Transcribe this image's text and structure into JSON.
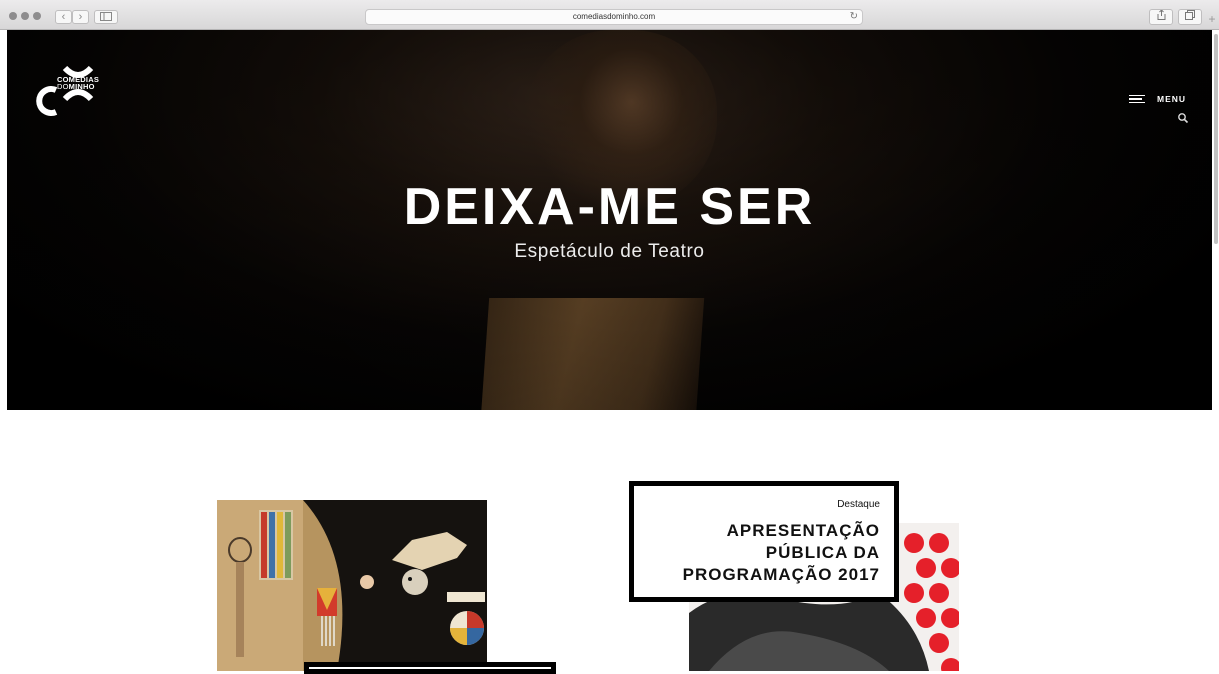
{
  "browser": {
    "url": "comediasdominho.com"
  },
  "site": {
    "logo_text_line1": "COMÉDIAS",
    "logo_text_line2_a": "DO",
    "logo_text_line2_b": "MINHO",
    "menu_label": "MENU"
  },
  "hero": {
    "title": "DEIXA-ME SER",
    "subtitle": "Espetáculo de Teatro"
  },
  "cards": [
    {
      "tag": "",
      "title": ""
    },
    {
      "tag": "Destaque",
      "title_line1": "APRESENTAÇÃO",
      "title_line2": "PÚBLICA DA",
      "title_line3": "PROGRAMAÇÃO 2017"
    }
  ],
  "colors": {
    "hero_bg": "#000000",
    "text_light": "#ffffff",
    "frame": "#000000",
    "polka_red": "#e5202a"
  },
  "icons": {
    "menu": "hamburger-icon",
    "search": "search-icon",
    "reload": "reload-icon"
  }
}
